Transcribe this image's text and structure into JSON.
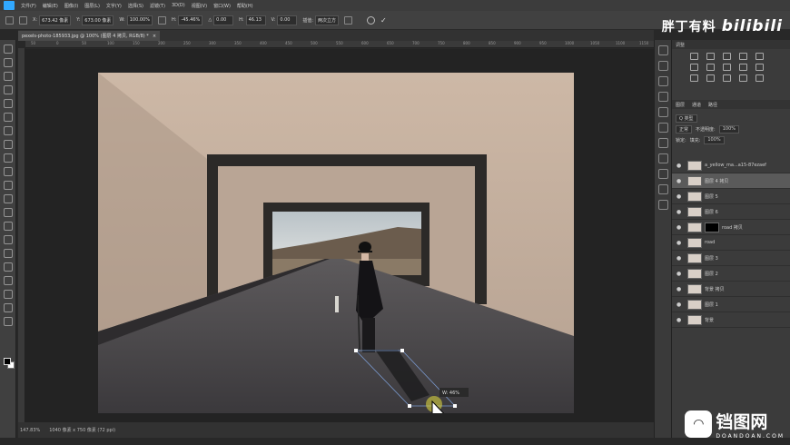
{
  "menu": {
    "items": [
      "文件(F)",
      "编辑(E)",
      "图像(I)",
      "图层(L)",
      "文字(Y)",
      "选择(S)",
      "滤镜(T)",
      "3D(D)",
      "视图(V)",
      "窗口(W)",
      "帮助(H)"
    ]
  },
  "options": {
    "x_label": "X:",
    "x_value": "673.42 像素",
    "y_label": "Y:",
    "y_value": "673.00 像素",
    "w_label": "W:",
    "w_value": "100.00%",
    "h_label": "H:",
    "h_value": "-45.46%",
    "angle_value": "0.00",
    "h_skew_label": "H:",
    "h_skew_value": "46.13",
    "v_skew_label": "V:",
    "v_skew_value": "0.00",
    "interp_label": "插值:",
    "interp_value": "两次立方"
  },
  "watermark_top": {
    "text1": "胖丁有料",
    "text2": "bilibili"
  },
  "tab": {
    "title": "pexels-photo-185933.jpg @ 100% (图层 4 拷贝, RGB/8) *",
    "close": "×"
  },
  "ruler": {
    "ticks": [
      "50",
      "0",
      "50",
      "100",
      "150",
      "200",
      "250",
      "300",
      "350",
      "400",
      "450",
      "500",
      "550",
      "600",
      "650",
      "700",
      "750",
      "800",
      "850",
      "900",
      "950",
      "1000",
      "1050",
      "1100",
      "1150"
    ]
  },
  "status": {
    "zoom": "147.83%",
    "doc": "1040 像素 x 750 像素 (72 ppi)"
  },
  "panel": {
    "adjust_header": "调整",
    "layers_tabs": [
      "图层",
      "通道",
      "路径"
    ],
    "kind_label": "Q 类型",
    "blend_mode": "正常",
    "opacity_label": "不透明度:",
    "opacity_value": "100%",
    "lock_label": "锁定:",
    "fill_label": "填充:",
    "fill_value": "100%"
  },
  "layers": [
    {
      "name": "a_yellow_ma...a15-87ezaef"
    },
    {
      "name": "图层 4 拷贝"
    },
    {
      "name": "图层 5"
    },
    {
      "name": "图层 6"
    },
    {
      "name": "road 拷贝"
    },
    {
      "name": "road"
    },
    {
      "name": "图层 3"
    },
    {
      "name": "图层 2"
    },
    {
      "name": "背景 拷贝"
    },
    {
      "name": "图层 1"
    },
    {
      "name": "背景"
    }
  ],
  "transform_hint": "W: 46%",
  "watermark_bot": {
    "cn": "铛图网",
    "en": "DOANDOAN.COM"
  }
}
